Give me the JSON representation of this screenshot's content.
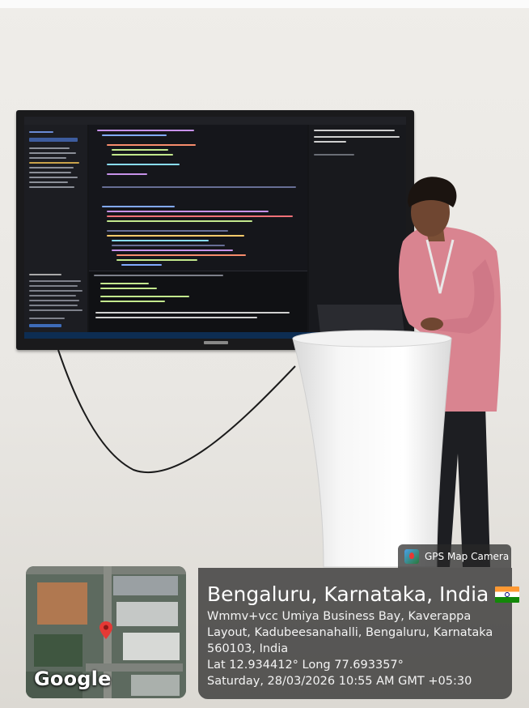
{
  "gps_badge": {
    "app_name": "GPS Map Camera",
    "icon": "gps-map-camera-icon"
  },
  "map": {
    "provider_label": "Google",
    "pin_icon": "location-pin-icon",
    "pin_color": "#e53935"
  },
  "location": {
    "city_line": "Bengaluru, Karnataka, India",
    "flag_icon": "india-flag-icon",
    "address_line_1": "Wmmv+vcc Umiya Business Bay, Kaverappa",
    "address_line_2": "Layout, Kadubeesanahalli, Bengaluru, Karnataka",
    "address_line_3": "560103, India",
    "coordinates": "Lat 12.934412° Long 77.693357°",
    "datetime": "Saturday, 28/03/2026 10:55 AM GMT +05:30"
  }
}
